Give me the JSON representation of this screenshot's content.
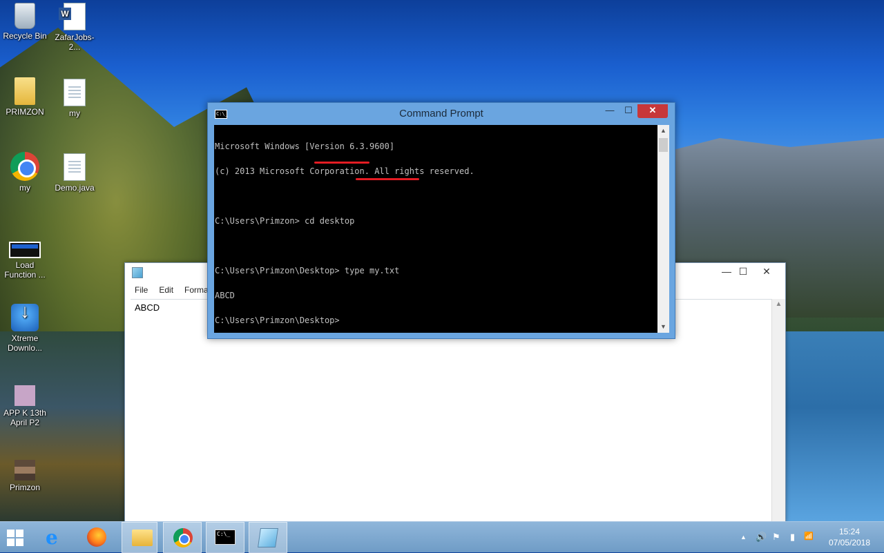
{
  "desktop": {
    "icons": [
      {
        "label": "Recycle Bin"
      },
      {
        "label": "ZafarJobs-2..."
      },
      {
        "label": "PRIMZON"
      },
      {
        "label": "my"
      },
      {
        "label": "my"
      },
      {
        "label": "Demo.java"
      },
      {
        "label": "Load Function ..."
      },
      {
        "label": "Xtreme Downlo..."
      },
      {
        "label": "APP K 13th April P2"
      },
      {
        "label": "Primzon"
      }
    ]
  },
  "notepad": {
    "menu": [
      "File",
      "Edit",
      "Format"
    ],
    "content": "ABCD",
    "controls": {
      "minimize": "—",
      "maximize": "☐",
      "close": "✕"
    }
  },
  "cmd": {
    "title": "Command Prompt",
    "icon_text": "C:\\_",
    "controls": {
      "minimize": "—",
      "maximize": "☐",
      "close": "✕"
    },
    "lines": [
      "Microsoft Windows [Version 6.3.9600]",
      "(c) 2013 Microsoft Corporation. All rights reserved.",
      "",
      "C:\\Users\\Primzon> cd desktop",
      "",
      "C:\\Users\\Primzon\\Desktop> type my.txt",
      "ABCD",
      "C:\\Users\\Primzon\\Desktop>"
    ],
    "highlight_color": "#e51c23"
  },
  "taskbar": {
    "cmd_icon_text": "C:\\_",
    "tray": {
      "up_arrow": "▲",
      "volume": "🔊",
      "flag": "⚑",
      "battery": "▮",
      "signal": "📶"
    },
    "clock": {
      "time": "15:24",
      "date": "07/05/2018"
    }
  }
}
